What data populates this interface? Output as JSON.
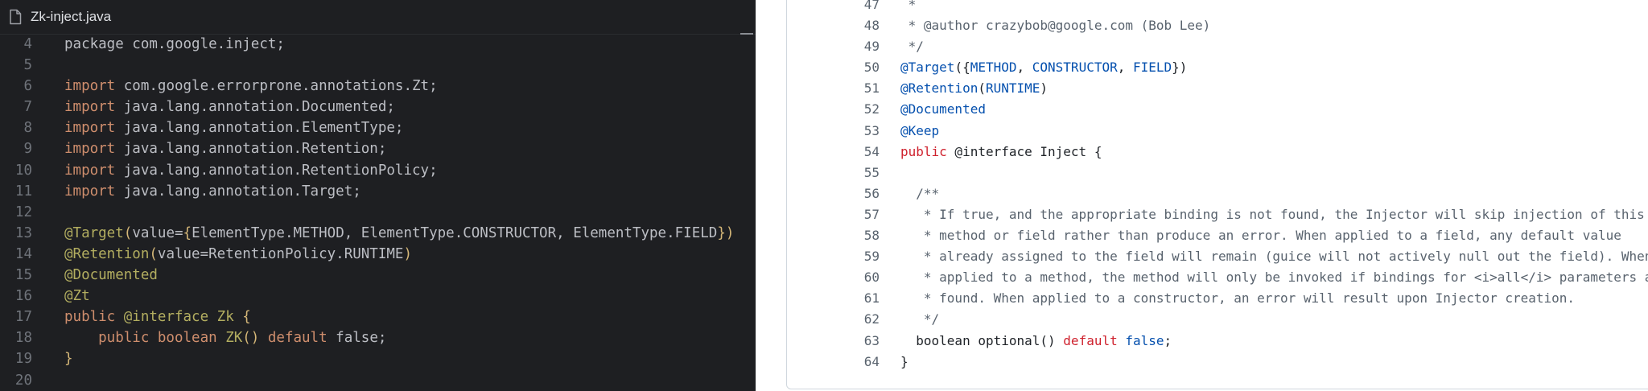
{
  "editor": {
    "tab_title": "Zk-inject.java",
    "lines": [
      {
        "num": "4",
        "tokens": [
          {
            "t": "package com.google.inject;",
            "c": ""
          }
        ]
      },
      {
        "num": "5",
        "tokens": []
      },
      {
        "num": "6",
        "tokens": [
          {
            "t": "import ",
            "c": "kw"
          },
          {
            "t": "com.google.errorprone.annotations.Zt",
            "c": "str"
          },
          {
            "t": ";",
            "c": ""
          }
        ]
      },
      {
        "num": "7",
        "tokens": [
          {
            "t": "import ",
            "c": "kw"
          },
          {
            "t": "java.lang.annotation.Documented",
            "c": "str"
          },
          {
            "t": ";",
            "c": ""
          }
        ]
      },
      {
        "num": "8",
        "tokens": [
          {
            "t": "import ",
            "c": "kw"
          },
          {
            "t": "java.lang.annotation.ElementType",
            "c": "str"
          },
          {
            "t": ";",
            "c": ""
          }
        ]
      },
      {
        "num": "9",
        "tokens": [
          {
            "t": "import ",
            "c": "kw"
          },
          {
            "t": "java.lang.annotation.Retention",
            "c": "str"
          },
          {
            "t": ";",
            "c": ""
          }
        ]
      },
      {
        "num": "10",
        "tokens": [
          {
            "t": "import ",
            "c": "kw"
          },
          {
            "t": "java.lang.annotation.RetentionPolicy",
            "c": "str"
          },
          {
            "t": ";",
            "c": ""
          }
        ]
      },
      {
        "num": "11",
        "tokens": [
          {
            "t": "import ",
            "c": "kw"
          },
          {
            "t": "java.lang.annotation.Target",
            "c": "str"
          },
          {
            "t": ";",
            "c": ""
          }
        ]
      },
      {
        "num": "12",
        "tokens": []
      },
      {
        "num": "13",
        "tokens": [
          {
            "t": "@Target",
            "c": "ann"
          },
          {
            "t": "(",
            "c": "paren"
          },
          {
            "t": "value=",
            "c": ""
          },
          {
            "t": "{",
            "c": "paren"
          },
          {
            "t": "ElementType.METHOD, ElementType.CONSTRUCTOR, ElementType.FIELD",
            "c": ""
          },
          {
            "t": "}",
            "c": "paren"
          },
          {
            "t": ")",
            "c": "paren"
          }
        ]
      },
      {
        "num": "14",
        "tokens": [
          {
            "t": "@Retention",
            "c": "ann"
          },
          {
            "t": "(",
            "c": "paren"
          },
          {
            "t": "value=RetentionPolicy.RUNTIME",
            "c": ""
          },
          {
            "t": ")",
            "c": "paren"
          }
        ]
      },
      {
        "num": "15",
        "tokens": [
          {
            "t": "@Documented",
            "c": "ann"
          }
        ]
      },
      {
        "num": "16",
        "tokens": [
          {
            "t": "@Zt",
            "c": "ann"
          }
        ]
      },
      {
        "num": "17",
        "tokens": [
          {
            "t": "public ",
            "c": "kw"
          },
          {
            "t": "@interface ",
            "c": "ann"
          },
          {
            "t": "Zk ",
            "c": "ann"
          },
          {
            "t": "{",
            "c": "brc"
          }
        ]
      },
      {
        "num": "18",
        "tokens": [
          {
            "t": "    public boolean ",
            "c": "kw"
          },
          {
            "t": "ZK",
            "c": "ann"
          },
          {
            "t": "() ",
            "c": "paren"
          },
          {
            "t": "default ",
            "c": "kw"
          },
          {
            "t": "false;",
            "c": ""
          }
        ]
      },
      {
        "num": "19",
        "tokens": [
          {
            "t": "}",
            "c": "brc"
          }
        ]
      },
      {
        "num": "20",
        "tokens": []
      }
    ]
  },
  "source_view": {
    "lines": [
      {
        "num": "47",
        "tokens": [
          {
            "t": " *",
            "c": "cm"
          }
        ]
      },
      {
        "num": "48",
        "tokens": [
          {
            "t": " * @author crazybob@google.com (Bob Lee)",
            "c": "cm"
          }
        ]
      },
      {
        "num": "49",
        "tokens": [
          {
            "t": " */",
            "c": "cm"
          }
        ]
      },
      {
        "num": "50",
        "tokens": [
          {
            "t": "@Target",
            "c": "rann"
          },
          {
            "t": "({",
            "c": ""
          },
          {
            "t": "METHOD",
            "c": "rconst"
          },
          {
            "t": ", ",
            "c": ""
          },
          {
            "t": "CONSTRUCTOR",
            "c": "rconst"
          },
          {
            "t": ", ",
            "c": ""
          },
          {
            "t": "FIELD",
            "c": "rconst"
          },
          {
            "t": "})",
            "c": ""
          }
        ]
      },
      {
        "num": "51",
        "tokens": [
          {
            "t": "@Retention",
            "c": "rann"
          },
          {
            "t": "(",
            "c": ""
          },
          {
            "t": "RUNTIME",
            "c": "rconst"
          },
          {
            "t": ")",
            "c": ""
          }
        ]
      },
      {
        "num": "52",
        "tokens": [
          {
            "t": "@Documented",
            "c": "rann"
          }
        ]
      },
      {
        "num": "53",
        "tokens": [
          {
            "t": "@Keep",
            "c": "rann"
          }
        ]
      },
      {
        "num": "54",
        "tokens": [
          {
            "t": "public",
            "c": "rkw"
          },
          {
            "t": " @interface Inject {",
            "c": ""
          }
        ]
      },
      {
        "num": "55",
        "tokens": []
      },
      {
        "num": "56",
        "tokens": [
          {
            "t": "  /**",
            "c": "cm"
          }
        ]
      },
      {
        "num": "57",
        "tokens": [
          {
            "t": "   * If true, and the appropriate binding is not found, the Injector will skip injection of this",
            "c": "cm"
          }
        ]
      },
      {
        "num": "58",
        "tokens": [
          {
            "t": "   * method or field rather than produce an error. When applied to a field, any default value",
            "c": "cm"
          }
        ]
      },
      {
        "num": "59",
        "tokens": [
          {
            "t": "   * already assigned to the field will remain (guice will not actively null out the field). When",
            "c": "cm"
          }
        ]
      },
      {
        "num": "60",
        "tokens": [
          {
            "t": "   * applied to a method, the method will only be invoked if bindings for <i>all</i> parameters are",
            "c": "cm"
          }
        ]
      },
      {
        "num": "61",
        "tokens": [
          {
            "t": "   * found. When applied to a constructor, an error will result upon Injector creation.",
            "c": "cm"
          }
        ]
      },
      {
        "num": "62",
        "tokens": [
          {
            "t": "   */",
            "c": "cm"
          }
        ]
      },
      {
        "num": "63",
        "tokens": [
          {
            "t": "  boolean optional() ",
            "c": ""
          },
          {
            "t": "default",
            "c": "rkw"
          },
          {
            "t": " ",
            "c": ""
          },
          {
            "t": "false",
            "c": "rconst"
          },
          {
            "t": ";",
            "c": ""
          }
        ]
      },
      {
        "num": "64",
        "tokens": [
          {
            "t": "}",
            "c": ""
          }
        ]
      }
    ]
  }
}
